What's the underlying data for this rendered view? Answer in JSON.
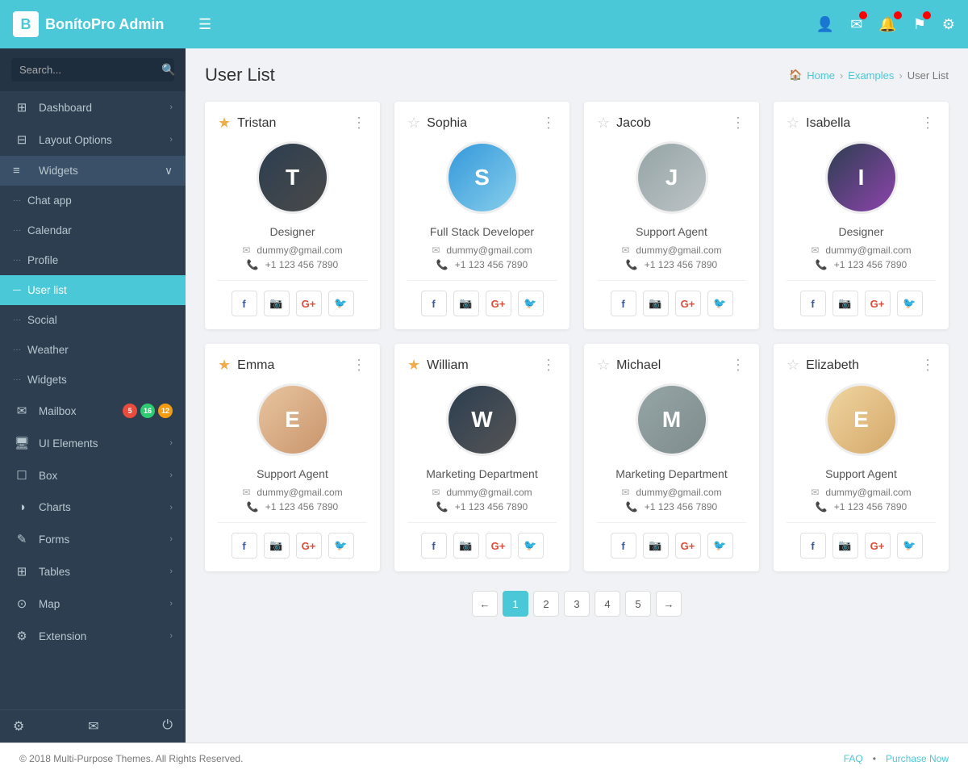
{
  "app": {
    "logo_letter": "B",
    "logo_name_start": "Bonito",
    "logo_name_end": "Pro",
    "logo_subtitle": "Admin",
    "menu_icon": "☰"
  },
  "header_icons": [
    {
      "name": "user-icon",
      "glyph": "👤",
      "badge": false
    },
    {
      "name": "mail-icon",
      "glyph": "✉",
      "badge": true
    },
    {
      "name": "bell-icon",
      "glyph": "🔔",
      "badge": true
    },
    {
      "name": "flag-icon",
      "glyph": "⚑",
      "badge": true
    },
    {
      "name": "gear-icon",
      "glyph": "⚙",
      "badge": false
    }
  ],
  "search": {
    "placeholder": "Search..."
  },
  "sidebar": {
    "items": [
      {
        "id": "dashboard",
        "label": "Dashboard",
        "icon": "⊞",
        "arrow": true,
        "active": false,
        "dots": false
      },
      {
        "id": "layout-options",
        "label": "Layout Options",
        "icon": "⊟",
        "arrow": true,
        "active": false,
        "dots": false
      },
      {
        "id": "widgets",
        "label": "Widgets",
        "icon": "≡",
        "arrow": true,
        "active": false,
        "dots": false,
        "section": true
      },
      {
        "id": "chat-app",
        "label": "Chat app",
        "icon": "",
        "arrow": false,
        "active": false,
        "dots": true
      },
      {
        "id": "calendar",
        "label": "Calendar",
        "icon": "",
        "arrow": false,
        "active": false,
        "dots": true
      },
      {
        "id": "profile",
        "label": "Profile",
        "icon": "",
        "arrow": false,
        "active": false,
        "dots": true
      },
      {
        "id": "user-list",
        "label": "User list",
        "icon": "",
        "arrow": false,
        "active": true,
        "dots": true
      },
      {
        "id": "social",
        "label": "Social",
        "icon": "",
        "arrow": false,
        "active": false,
        "dots": true
      },
      {
        "id": "weather",
        "label": "Weather",
        "icon": "",
        "arrow": false,
        "active": false,
        "dots": true
      },
      {
        "id": "widgets-sub",
        "label": "Widgets",
        "icon": "",
        "arrow": false,
        "active": false,
        "dots": true
      },
      {
        "id": "mailbox",
        "label": "Mailbox",
        "icon": "✉",
        "arrow": false,
        "active": false,
        "dots": false,
        "mailbox": true,
        "badges": [
          {
            "val": "5",
            "color": "#e74c3c"
          },
          {
            "val": "16",
            "color": "#2ecc71"
          },
          {
            "val": "12",
            "color": "#f39c12"
          }
        ]
      },
      {
        "id": "ui-elements",
        "label": "UI Elements",
        "icon": "🖥",
        "arrow": true,
        "active": false,
        "dots": false
      },
      {
        "id": "box",
        "label": "Box",
        "icon": "☐",
        "arrow": true,
        "active": false,
        "dots": false
      },
      {
        "id": "charts",
        "label": "Charts",
        "icon": "◑",
        "arrow": true,
        "active": false,
        "dots": false
      },
      {
        "id": "forms",
        "label": "Forms",
        "icon": "✎",
        "arrow": true,
        "active": false,
        "dots": false
      },
      {
        "id": "tables",
        "label": "Tables",
        "icon": "⊞",
        "arrow": true,
        "active": false,
        "dots": false
      },
      {
        "id": "map",
        "label": "Map",
        "icon": "⊙",
        "arrow": true,
        "active": false,
        "dots": false
      },
      {
        "id": "extension",
        "label": "Extension",
        "icon": "⚙",
        "arrow": true,
        "active": false,
        "dots": false
      }
    ],
    "footer_icons": [
      {
        "name": "settings-icon",
        "glyph": "⚙"
      },
      {
        "name": "mail-footer-icon",
        "glyph": "✉"
      },
      {
        "name": "power-icon",
        "glyph": "⏻"
      }
    ]
  },
  "page": {
    "title": "User List",
    "breadcrumb": [
      "Home",
      "Examples",
      "User List"
    ]
  },
  "users": [
    {
      "name": "Tristan",
      "star": true,
      "role": "Designer",
      "email": "dummy@gmail.com",
      "phone": "+1 123 456 7890",
      "av_class": "av-tristan",
      "av_letter": "T"
    },
    {
      "name": "Sophia",
      "star": false,
      "role": "Full Stack Developer",
      "email": "dummy@gmail.com",
      "phone": "+1 123 456 7890",
      "av_class": "av-sophia",
      "av_letter": "S"
    },
    {
      "name": "Jacob",
      "star": false,
      "role": "Support Agent",
      "email": "dummy@gmail.com",
      "phone": "+1 123 456 7890",
      "av_class": "av-jacob",
      "av_letter": "J"
    },
    {
      "name": "Isabella",
      "star": false,
      "role": "Designer",
      "email": "dummy@gmail.com",
      "phone": "+1 123 456 7890",
      "av_class": "av-isabella",
      "av_letter": "I"
    },
    {
      "name": "Emma",
      "star": true,
      "role": "Support Agent",
      "email": "dummy@gmail.com",
      "phone": "+1 123 456 7890",
      "av_class": "av-emma",
      "av_letter": "E"
    },
    {
      "name": "William",
      "star": true,
      "role": "Marketing Department",
      "email": "dummy@gmail.com",
      "phone": "+1 123 456 7890",
      "av_class": "av-william",
      "av_letter": "W"
    },
    {
      "name": "Michael",
      "star": false,
      "role": "Marketing Department",
      "email": "dummy@gmail.com",
      "phone": "+1 123 456 7890",
      "av_class": "av-michael",
      "av_letter": "M"
    },
    {
      "name": "Elizabeth",
      "star": false,
      "role": "Support Agent",
      "email": "dummy@gmail.com",
      "phone": "+1 123 456 7890",
      "av_class": "av-elizabeth",
      "av_letter": "E"
    }
  ],
  "pagination": {
    "prev": "←",
    "next": "→",
    "pages": [
      "1",
      "2",
      "3",
      "4",
      "5"
    ],
    "active": "1"
  },
  "footer": {
    "copyright": "© 2018 Multi-Purpose Themes. All Rights Reserved.",
    "links": [
      "FAQ",
      "Purchase Now"
    ]
  },
  "social_icons": [
    {
      "label": "f",
      "class": "social-fb"
    },
    {
      "label": "in",
      "class": "social-ig"
    },
    {
      "label": "G+",
      "class": "social-gg"
    },
    {
      "label": "t",
      "class": "social-tw"
    }
  ]
}
